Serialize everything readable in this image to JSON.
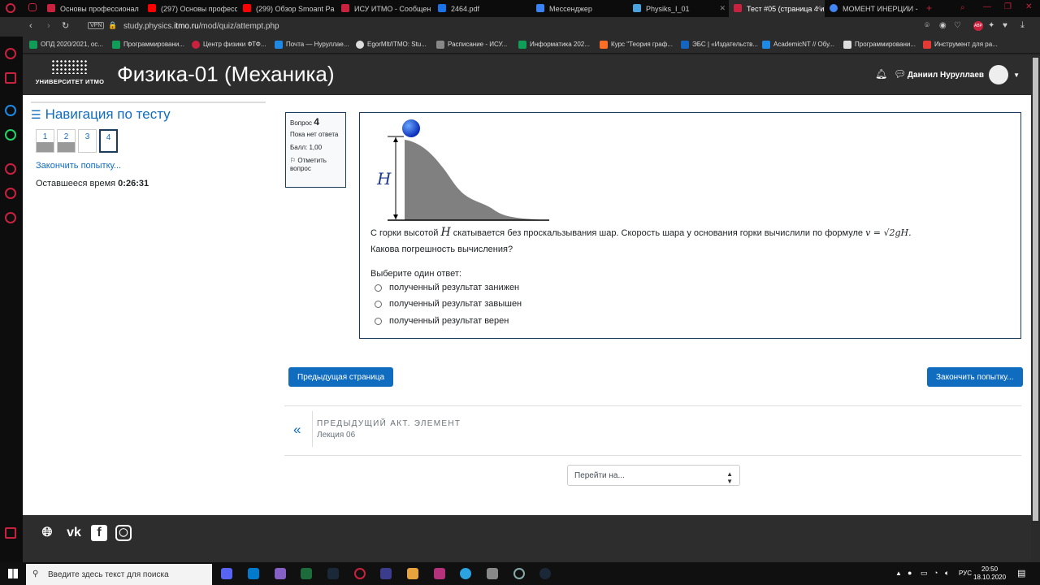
{
  "browser": {
    "tabs": [
      {
        "title": "Основы профессионал",
        "color": "#c9223f"
      },
      {
        "title": "(297) Основы професс",
        "color": "#ff0000"
      },
      {
        "title": "(299) Обзор Smoant Pa",
        "color": "#ff0000"
      },
      {
        "title": "ИСУ ИТМО - Сообщен",
        "color": "#c9223f"
      },
      {
        "title": "2464.pdf",
        "color": "#1a73e8"
      },
      {
        "title": "Мессенджер",
        "color": "#3b82f6"
      },
      {
        "title": "Physiks_I_01",
        "color": "#4aa3df"
      },
      {
        "title": "Тест #05 (страница 4 и",
        "color": "#c9223f"
      },
      {
        "title": "МОМЕНТ ИНЕРЦИИ -",
        "color": "#4285f4"
      }
    ],
    "vpn": "VPN",
    "url_prefix": "study.physics.",
    "url_domain": "itmo.ru",
    "url_path": "/mod/quiz/attempt.php",
    "bookmarks": [
      "ОПД 2020/2021, ос...",
      "Программировани...",
      "Центр физики ФТФ...",
      "Почта — Нуруллае...",
      "EgorMlt/ITMO: Stu...",
      "Расписание - ИСУ...",
      "Информатика 202...",
      "Курс \"Теория граф...",
      "ЭБС | «Издательств...",
      "AcademicNT // Обу...",
      "Программировани...",
      "Инструмент для ра..."
    ]
  },
  "header": {
    "logo_text": "УНИВЕРСИТЕТ ИТМО",
    "course_title": "Физика-01 (Механика)",
    "user_name": "Даниил Нуруллаев"
  },
  "nav": {
    "title": "Навигация по тесту",
    "questions": [
      "1",
      "2",
      "3",
      "4"
    ],
    "finish_link": "Закончить попытку...",
    "time_label": "Оставшееся время",
    "time_value": "0:26:31"
  },
  "question": {
    "label": "Вопрос",
    "number": "4",
    "status": "Пока нет ответа",
    "score": "Балл: 1,00",
    "flag": "Отметить вопрос",
    "figure_label": "H",
    "text_before": "С горки высотой",
    "text_var": "H",
    "text_after": "скатывается без проскальзывания шар. Скорость шара у основания горки вычислили по формуле",
    "formula": "v = √2gH.",
    "text2": "Какова погрешность вычисления?",
    "prompt": "Выберите один ответ:",
    "options": [
      "полученный результат занижен",
      "полученный результат завышен",
      "полученный результат верен"
    ]
  },
  "buttons": {
    "prev_page": "Предыдущая страница",
    "finish": "Закончить попытку..."
  },
  "prev_activity": {
    "label": "ПРЕДЫДУЩИЙ АКТ. ЭЛЕМЕНТ",
    "name": "Лекция 06"
  },
  "jump": {
    "placeholder": "Перейти на..."
  },
  "taskbar": {
    "search_placeholder": "Введите здесь текст для поиска",
    "lang": "РУС",
    "time": "20:50",
    "date": "18.10.2020"
  }
}
